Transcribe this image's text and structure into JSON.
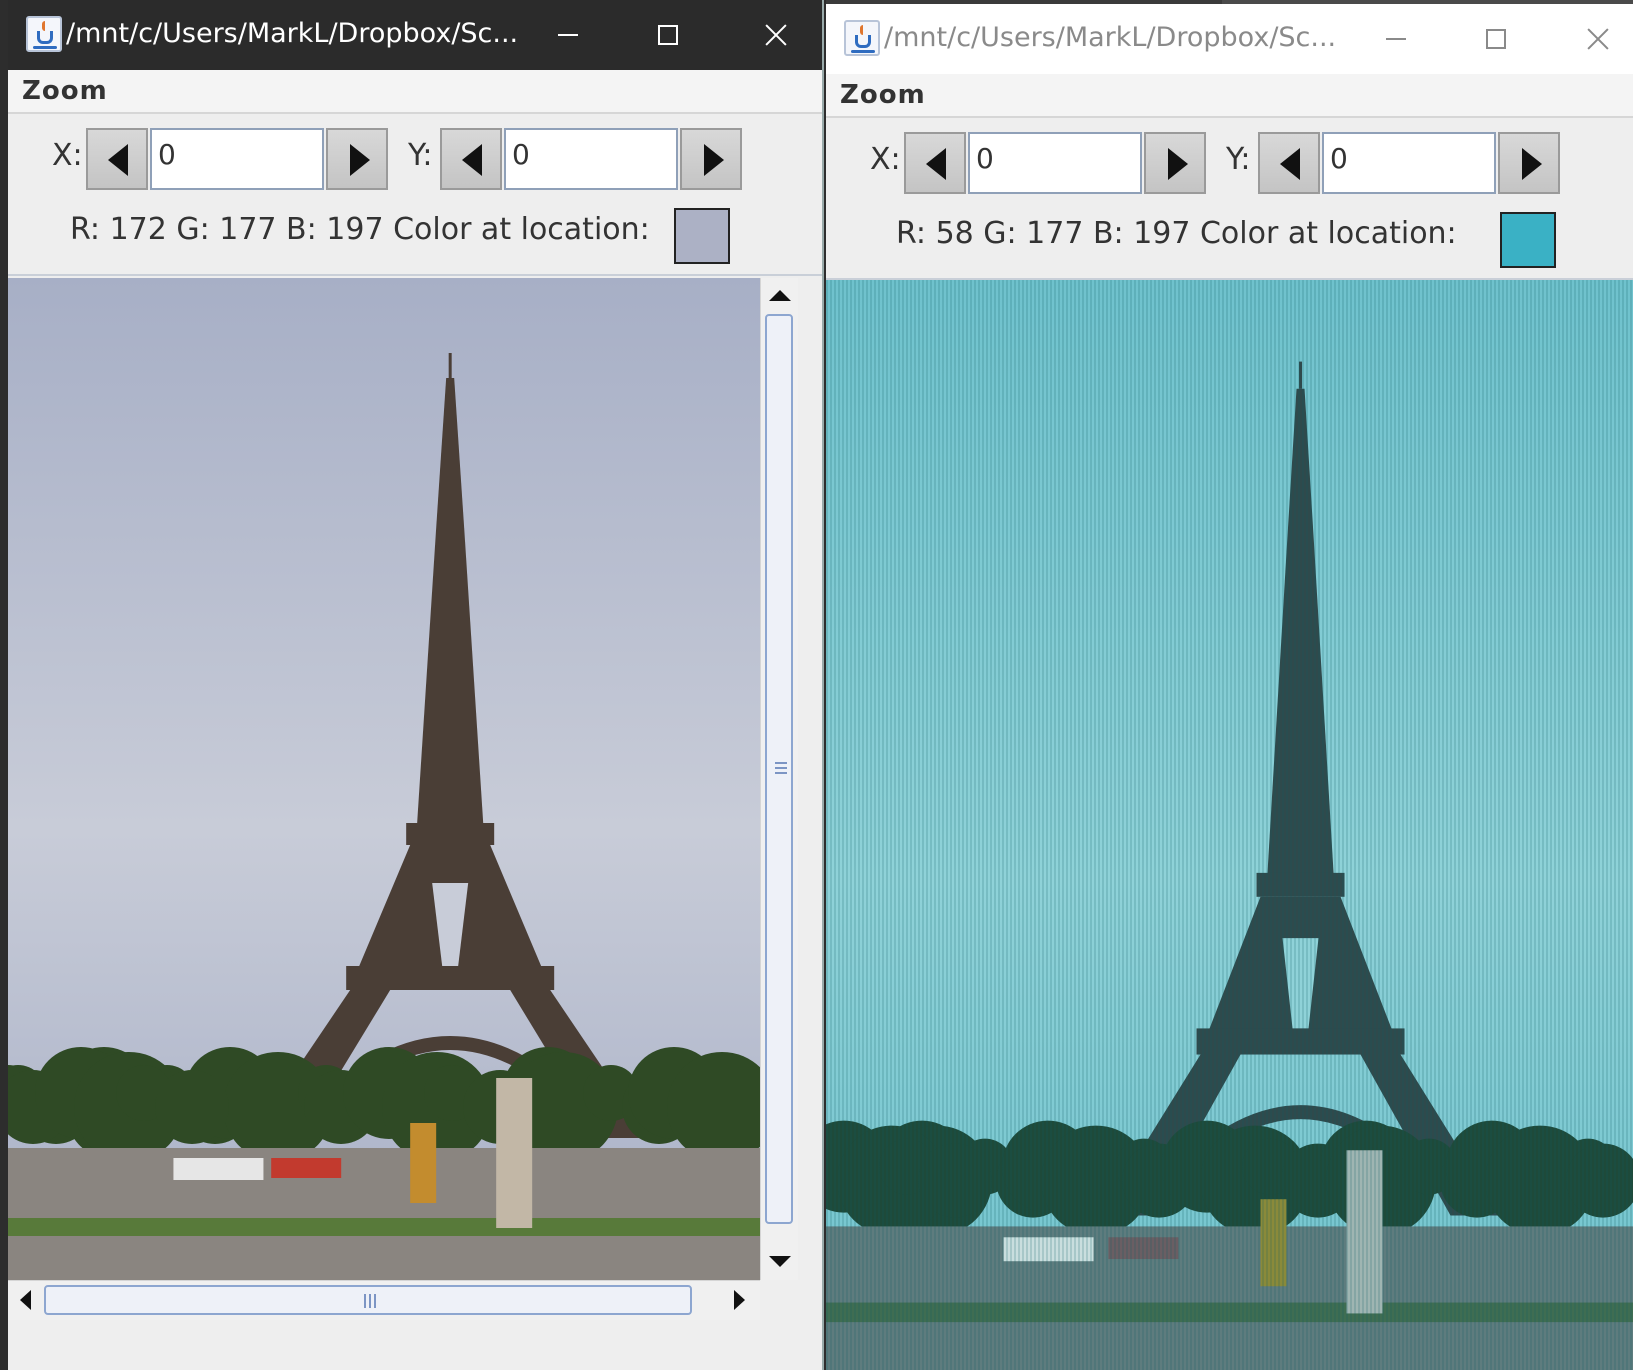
{
  "windows": [
    {
      "title": "/mnt/c/Users/MarkL/Dropbox/Sc...",
      "active": true,
      "menu": {
        "zoom": "Zoom"
      },
      "x": {
        "label": "X:",
        "value": "0"
      },
      "y": {
        "label": "Y:",
        "value": "0"
      },
      "color_text": "R: 172  G: 177  B: 197  Color at location:",
      "swatch_color": "#acb1c5",
      "image_tint": "original"
    },
    {
      "title": "/mnt/c/Users/MarkL/Dropbox/Sc...",
      "active": false,
      "menu": {
        "zoom": "Zoom"
      },
      "x": {
        "label": "X:",
        "value": "0"
      },
      "y": {
        "label": "Y:",
        "value": "0"
      },
      "color_text": "R: 58  G: 177  B: 197  Color at location:",
      "swatch_color": "#3ab1c5",
      "image_tint": "cyan"
    }
  ],
  "icons": {
    "app": "java-icon",
    "minimize": "minimize-icon",
    "maximize": "maximize-icon",
    "close": "close-icon",
    "prev": "left-arrow-icon",
    "next": "right-arrow-icon"
  },
  "colors": {
    "sky_original": "#aab2c8",
    "sky_cyan": "#7cc7d0",
    "tower_original": "#4a3e36",
    "tower_cyan": "#2f4a4c"
  }
}
